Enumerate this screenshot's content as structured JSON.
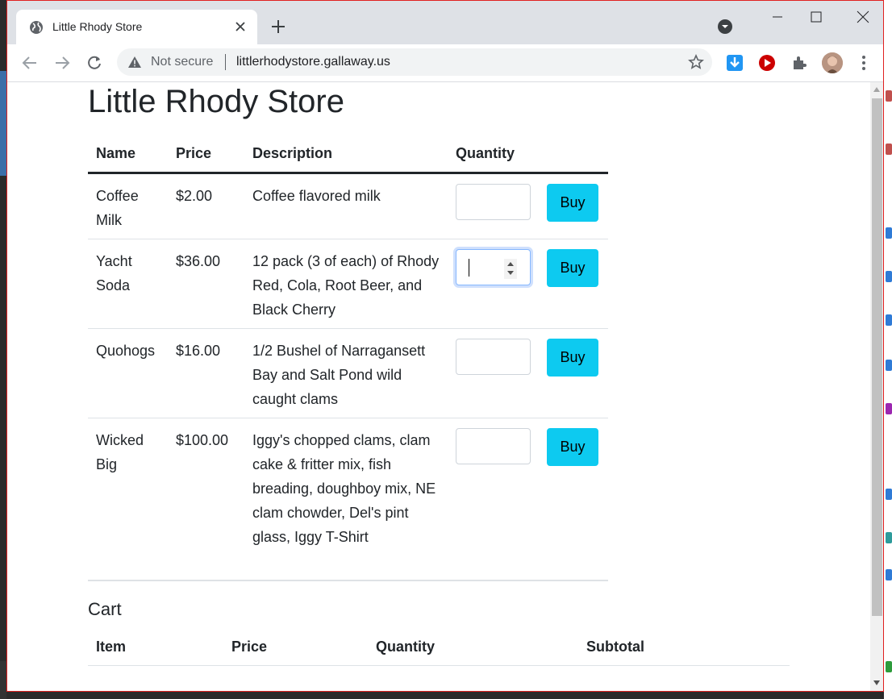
{
  "browser": {
    "tab_title": "Little Rhody Store",
    "security_label": "Not secure",
    "url": "littlerhodystore.gallaway.us"
  },
  "page": {
    "title": "Little Rhody Store",
    "columns": [
      "Name",
      "Price",
      "Description",
      "Quantity"
    ],
    "products": [
      {
        "name": "Coffee Milk",
        "price": "$2.00",
        "description": "Coffee flavored milk",
        "quantity": "",
        "buy_label": "Buy"
      },
      {
        "name": "Yacht Soda",
        "price": "$36.00",
        "description": "12 pack (3 of each) of Rhody Red, Cola, Root Beer, and Black Cherry",
        "quantity": "",
        "buy_label": "Buy"
      },
      {
        "name": "Quohogs",
        "price": "$16.00",
        "description": "1/2 Bushel of Narragansett Bay and Salt Pond wild caught clams",
        "quantity": "",
        "buy_label": "Buy"
      },
      {
        "name": "Wicked Big",
        "price": "$100.00",
        "description": "Iggy's chopped clams, clam cake & fritter mix, fish breading, doughboy mix, NE clam chowder, Del's pint glass, Iggy T-Shirt",
        "quantity": "",
        "buy_label": "Buy"
      }
    ],
    "cart": {
      "title": "Cart",
      "columns": [
        "Item",
        "Price",
        "Quantity",
        "Subtotal"
      ]
    }
  },
  "colors": {
    "buy_button": "#0dcaf0",
    "text": "#212529",
    "window_border": "#e02020"
  },
  "icons": [
    "globe-icon",
    "close-icon",
    "plus-icon",
    "back-icon",
    "forward-icon",
    "reload-icon",
    "warning-icon",
    "star-icon",
    "download-icon",
    "play-icon",
    "puzzle-icon",
    "kebab-menu-icon"
  ]
}
